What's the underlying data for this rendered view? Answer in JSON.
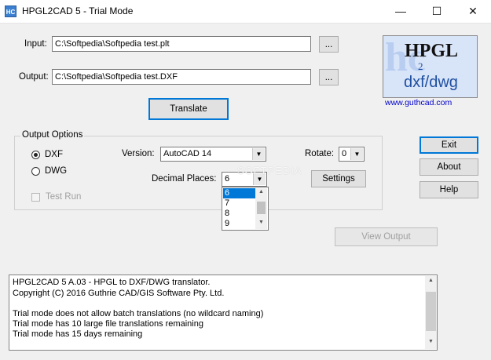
{
  "window": {
    "icon_text": "HC",
    "title": "HPGL2CAD 5 - Trial Mode",
    "minimize_glyph": "—",
    "maximize_glyph": "☐",
    "close_glyph": "✕"
  },
  "input": {
    "label": "Input:",
    "value": "C:\\Softpedia\\Softpedia test.plt",
    "browse_label": "..."
  },
  "output": {
    "label": "Output:",
    "value": "C:\\Softpedia\\Softpedia test.DXF",
    "browse_label": "..."
  },
  "logo": {
    "line1": "HPGL",
    "line2": "2",
    "line3": "dxf/dwg",
    "url": "www.guthcad.com"
  },
  "translate_label": "Translate",
  "options": {
    "title": "Output Options",
    "dxf_label": "DXF",
    "dwg_label": "DWG",
    "selected_format": "DXF",
    "test_run_label": "Test Run",
    "version_label": "Version:",
    "version_value": "AutoCAD 14",
    "rotate_label": "Rotate:",
    "rotate_value": "0",
    "decimal_label": "Decimal Places:",
    "decimal_value": "6",
    "decimal_options": [
      "6",
      "7",
      "8",
      "9"
    ],
    "settings_label": "Settings"
  },
  "buttons": {
    "exit": "Exit",
    "about": "About",
    "help": "Help",
    "view_output": "View Output"
  },
  "watermark": "SOFTPEDIA",
  "log_lines": [
    "HPGL2CAD 5 A.03 - HPGL to DXF/DWG translator.",
    "Copyright (C) 2016 Guthrie CAD/GIS Software Pty. Ltd.",
    "",
    "Trial mode does not allow batch translations (no wildcard naming)",
    "Trial mode has 10 large file translations remaining",
    "Trial mode has 15 days remaining"
  ],
  "icons": [
    "app-icon",
    "minimize-icon",
    "maximize-icon",
    "close-icon",
    "dropdown-arrow-icon",
    "scroll-up-icon",
    "scroll-down-icon"
  ]
}
